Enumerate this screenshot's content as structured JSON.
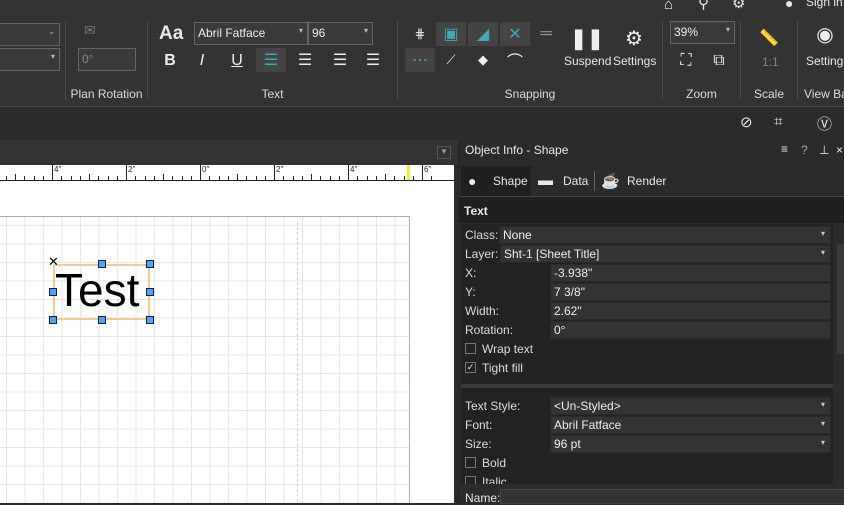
{
  "topbar": {
    "signin": "Sign in"
  },
  "ribbon": {
    "plan_rotation": {
      "value": "0°",
      "label": "Plan Rotation"
    },
    "text": {
      "label": "Text",
      "font": "Abril Fatface",
      "size": "96",
      "font_case_icon": "Aa",
      "bold": "B",
      "italic": "I",
      "underline": "U"
    },
    "snapping": {
      "label": "Snapping",
      "suspend": "Suspend",
      "settings": "Settings"
    },
    "zoom": {
      "label": "Zoom",
      "value": "39%"
    },
    "scale": {
      "label": "Scale",
      "value": "1:1"
    },
    "view_bar": {
      "label": "View Ba",
      "settings": "Settings"
    }
  },
  "ruler": {
    "labels": [
      "4\"",
      "2\"",
      "0\"",
      "2\"",
      "4\"",
      "6\""
    ]
  },
  "canvas": {
    "text_object": "Test"
  },
  "panel": {
    "title": "Object Info - Shape",
    "controls": [
      "≡",
      "?",
      "⊥",
      "×"
    ],
    "tabs": [
      {
        "label": "Shape",
        "active": true
      },
      {
        "label": "Data"
      },
      {
        "label": "Render"
      }
    ],
    "section": "Text",
    "fields": {
      "class": {
        "label": "Class:",
        "value": "None"
      },
      "layer": {
        "label": "Layer:",
        "value": "Sht-1 [Sheet Title]"
      },
      "x": {
        "label": "X:",
        "value": "-3.938\""
      },
      "y": {
        "label": "Y:",
        "value": "7 3/8\""
      },
      "width": {
        "label": "Width:",
        "value": "2.62\""
      },
      "rotation": {
        "label": "Rotation:",
        "value": "0°"
      },
      "wrap_text": {
        "label": "Wrap text",
        "checked": false
      },
      "tight_fill": {
        "label": "Tight fill",
        "checked": true
      },
      "text_style": {
        "label": "Text Style:",
        "value": "<Un-Styled>"
      },
      "font": {
        "label": "Font:",
        "value": "Abril Fatface"
      },
      "size": {
        "label": "Size:",
        "value": "96 pt"
      },
      "bold": {
        "label": "Bold",
        "checked": false
      },
      "italic": {
        "label": "Italic",
        "checked": false
      },
      "name": {
        "label": "Name:",
        "value": ""
      }
    }
  },
  "colors": {
    "accent": "#3fa9b5",
    "selection": "#f9c98f",
    "handle": "#4da3ff"
  }
}
